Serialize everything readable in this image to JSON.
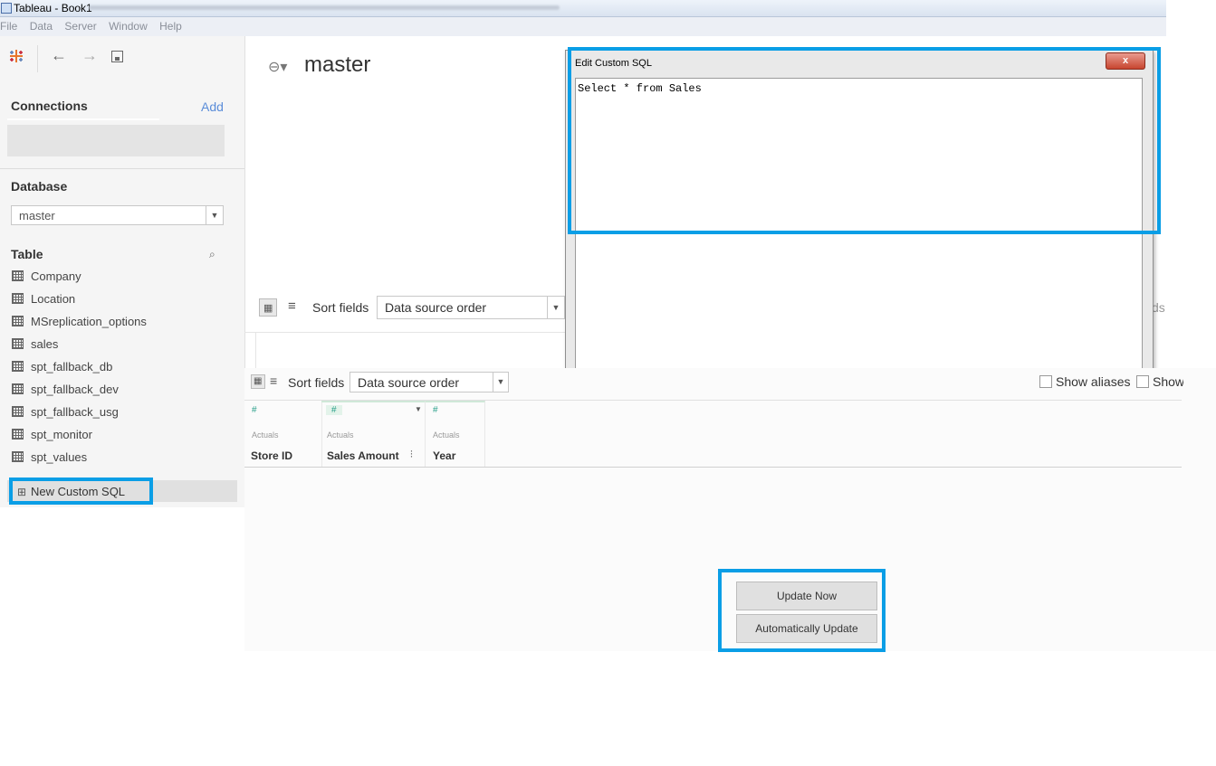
{
  "window": {
    "title": "Tableau - Book1"
  },
  "menu": [
    "File",
    "Data",
    "Server",
    "Window",
    "Help"
  ],
  "left_panel": {
    "connections_label": "Connections",
    "add_label": "Add",
    "database_label": "Database",
    "database_value": "master",
    "table_label": "Table",
    "tables": [
      "Company",
      "Location",
      "MSreplication_options",
      "sales",
      "spt_fallback_db",
      "spt_fallback_dev",
      "spt_fallback_usg",
      "spt_monitor",
      "spt_values"
    ],
    "new_custom_sql": "New Custom SQL"
  },
  "datasource": {
    "title": "master"
  },
  "toolbar_upper": {
    "sort_label": "Sort fields",
    "sort_value": "Data source order",
    "clipped_text": "ds"
  },
  "dialog": {
    "title": "Edit Custom SQL",
    "close_label": "x",
    "sql": "Select * from Sales"
  },
  "toolbar_lower": {
    "sort_label": "Sort fields",
    "sort_value": "Data source order",
    "show_aliases": "Show aliases",
    "show_clipped": "Show"
  },
  "columns": [
    {
      "type": "#",
      "source": "Actuals",
      "name": "Store ID"
    },
    {
      "type": "#",
      "source": "Actuals",
      "name": "Sales Amount"
    },
    {
      "type": "#",
      "source": "Actuals",
      "name": "Year"
    }
  ],
  "buttons": {
    "update_now": "Update Now",
    "auto_update": "Automatically Update"
  },
  "colors": {
    "highlight": "#0a9ee6",
    "accent_green": "#2aa08a"
  }
}
